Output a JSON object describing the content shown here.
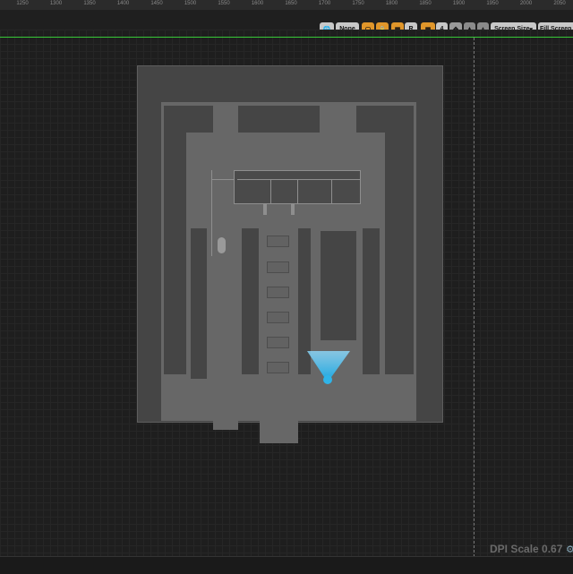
{
  "ruler": {
    "labels": [
      "1250",
      "1300",
      "1350",
      "1400",
      "1450",
      "1500",
      "1550",
      "1600",
      "1650",
      "1700",
      "1750",
      "1800",
      "1850",
      "1900",
      "1950",
      "2000",
      "2050"
    ]
  },
  "toolbar": {
    "globe_icon": "globe-icon",
    "localization": "None",
    "grid_snap_value": "4",
    "r_label": "R",
    "screen_size": "Screen Size",
    "fill_screen": "Fill Screen"
  },
  "status": {
    "dpi_scale": "DPI Scale 0.67"
  },
  "colors": {
    "accent": "#e0962a",
    "selection": "#37c837",
    "marker": "#2fb4e8"
  }
}
